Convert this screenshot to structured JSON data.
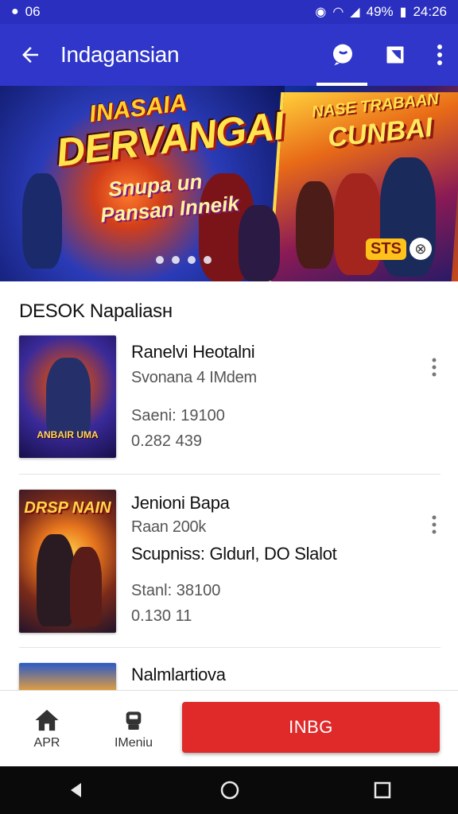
{
  "status_bar": {
    "left_text": "06",
    "battery": "49%",
    "time": "24:26"
  },
  "app_bar": {
    "title": "Indagansian",
    "back_icon": "arrow-left-icon",
    "actions": [
      "chat-bubble-icon",
      "bookmark-icon",
      "more-vert-icon"
    ]
  },
  "banner": {
    "headline_top": "INASAIA",
    "headline_main": "DERVANGAI",
    "sub_line1": "Snupa un",
    "sub_line2": "Pansan Inneik",
    "right_title_top": "NASE TRABAAN",
    "right_title_main": "CUNBAI",
    "badge_text": "STS",
    "badge_icon": "close-circle-icon",
    "dots": 4
  },
  "section": {
    "title": "DESOK Napaliasн"
  },
  "items": [
    {
      "poster_caption": "ANBAIR UMA",
      "title": "Ranelvi Heotalni",
      "subtitle": "Svonana 4 IMdem",
      "detail": "",
      "stat1": "Saeni: 19100",
      "stat2": "0.282 439"
    },
    {
      "poster_caption": "DRSP NAIN",
      "title": "Jenioni Bapa",
      "subtitle": "Raan 200k",
      "detail": "Scupniss: Gldurl, DO Slalot",
      "stat1": "Stanl: 38100",
      "stat2": "0.130 11"
    },
    {
      "poster_caption": "",
      "title": "Nalmlartiova",
      "subtitle": "",
      "detail": "",
      "stat1": "",
      "stat2": ""
    }
  ],
  "bottom_nav": {
    "home_label": "APR",
    "home_icon": "home-icon",
    "second_label": "IMeniu",
    "second_icon": "robot-icon",
    "cta_label": "INBG"
  },
  "system_nav": [
    "back-triangle-icon",
    "home-circle-icon",
    "recents-square-icon"
  ],
  "colors": {
    "primary": "#2f36c9",
    "status": "#2b2fbf",
    "cta": "#e02a2a"
  }
}
